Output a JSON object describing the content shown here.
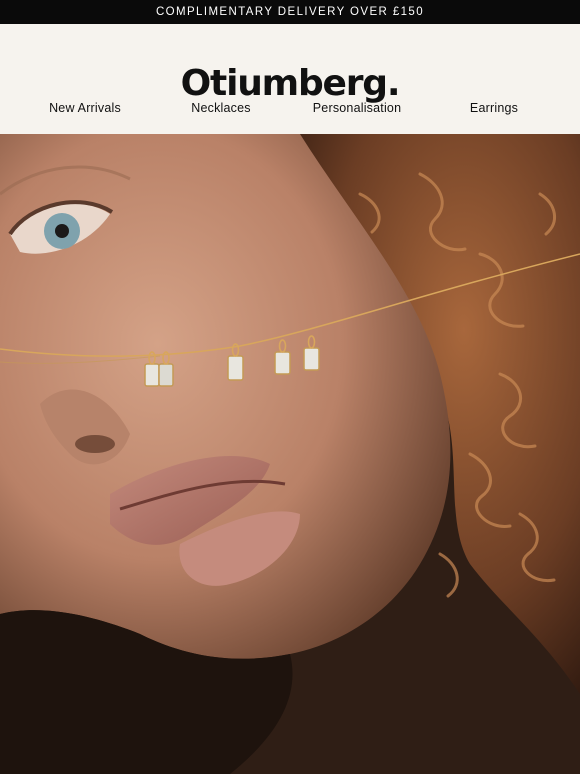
{
  "announcement": {
    "text": "COMPLIMENTARY DELIVERY OVER £150"
  },
  "header": {
    "logo_text": "Otiumberg."
  },
  "nav": {
    "items": [
      {
        "label": "New Arrivals"
      },
      {
        "label": "Necklaces"
      },
      {
        "label": "Personalisation"
      },
      {
        "label": "Earrings"
      }
    ]
  },
  "hero": {
    "colors": {
      "skin": "#c9957a",
      "hair": "#6b3d24",
      "shadow": "#2a1a12",
      "gold": "#d8a65c",
      "eye": "#7fa2ad",
      "lip": "#b9786c"
    }
  }
}
